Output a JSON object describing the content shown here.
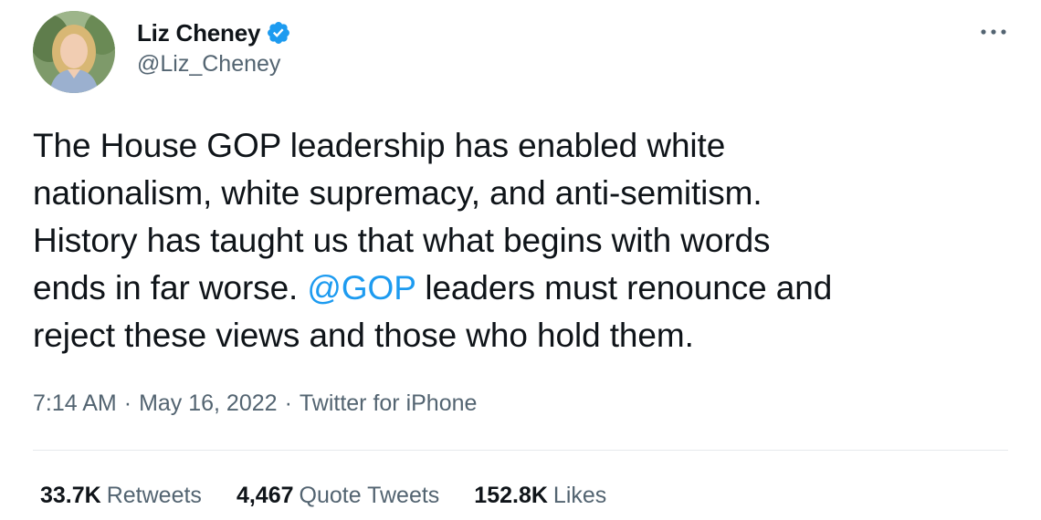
{
  "author": {
    "display_name": "Liz Cheney",
    "handle": "@Liz_Cheney",
    "verified": true
  },
  "tweet": {
    "lines": [
      "The House GOP leadership has enabled white",
      "nationalism, white supremacy, and anti-semitism.",
      "History has taught us that what begins with words"
    ],
    "line4_before": "ends in far worse. ",
    "mention": "@GOP",
    "line4_after": " leaders must renounce and",
    "line5": "reject these views and those who hold them."
  },
  "meta": {
    "time": "7:14 AM",
    "separator": "·",
    "date": "May 16, 2022",
    "source": "Twitter for iPhone"
  },
  "stats": {
    "retweets_count": "33.7K",
    "retweets_label": "Retweets",
    "quotes_count": "4,467",
    "quotes_label": "Quote Tweets",
    "likes_count": "152.8K",
    "likes_label": "Likes"
  },
  "icons": {
    "more": "more-icon",
    "verified": "verified-badge-icon"
  },
  "colors": {
    "text": "#0f1419",
    "secondary": "#536471",
    "link": "#1d9bf0",
    "verified": "#1d9bf0",
    "divider": "#e6e9ec"
  }
}
